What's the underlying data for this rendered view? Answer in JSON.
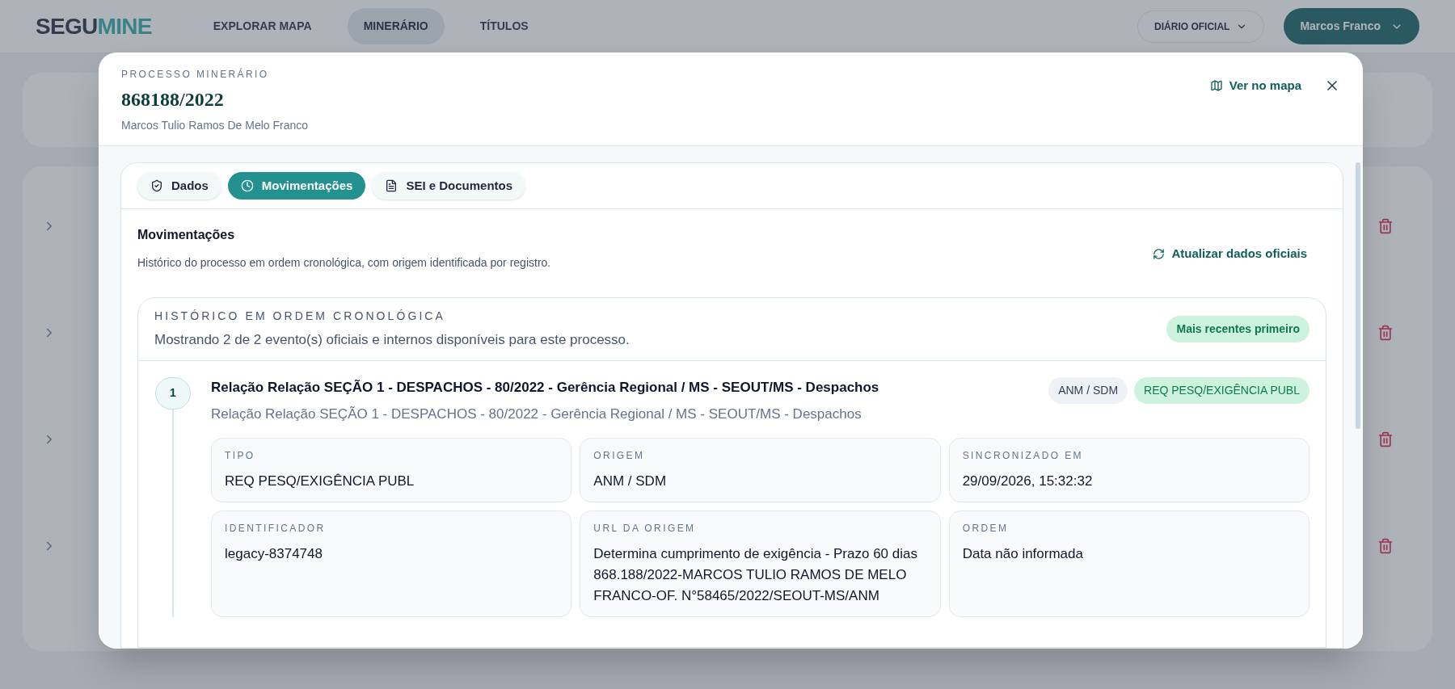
{
  "nav": {
    "logo_part_1": "SEGU",
    "logo_part_2": "MINE",
    "links": [
      {
        "label": "EXPLORAR MAPA",
        "selected": false
      },
      {
        "label": "MINERÁRIO",
        "selected": true
      },
      {
        "label": "TÍTULOS",
        "selected": false
      }
    ],
    "journal_menu": "DIÁRIO OFICIAL",
    "user_menu": "Marcos Franco"
  },
  "modal": {
    "eyebrow": "PROCESSO MINERÁRIO",
    "title": "868188/2022",
    "subtitle": "Marcos Tulio Ramos De Melo Franco",
    "map_link": "Ver no mapa",
    "tabs": [
      {
        "label": "Dados",
        "selected": false
      },
      {
        "label": "Movimentações",
        "selected": true
      },
      {
        "label": "SEI e Documentos",
        "selected": false
      }
    ],
    "section": {
      "title": "Movimentações",
      "description": "Histórico do processo em ordem cronológica, com origem identificada por registro.",
      "refresh_button": "Atualizar dados oficiais"
    },
    "history": {
      "eyebrow": "HISTÓRICO EM ORDEM CRONOLÓGICA",
      "summary": "Mostrando 2 de 2 evento(s) oficiais e internos disponíveis para este processo.",
      "order_badge": "Mais recentes primeiro"
    },
    "events": [
      {
        "number": "1",
        "title": "Relação Relação SEÇÃO 1 - DESPACHOS - 80/2022 - Gerência Regional / MS - SEOUT/MS - Despachos",
        "subtitle": "Relação Relação SEÇÃO 1 - DESPACHOS - 80/2022 - Gerência Regional / MS - SEOUT/MS - Despachos",
        "tags": [
          {
            "label": "ANM / SDM",
            "kind": "neutral"
          },
          {
            "label": "REQ PESQ/EXIGÊNCIA PUBL",
            "kind": "success"
          }
        ],
        "fields": [
          {
            "label": "TIPO",
            "value": "REQ PESQ/EXIGÊNCIA PUBL"
          },
          {
            "label": "ORIGEM",
            "value": "ANM / SDM"
          },
          {
            "label": "SINCRONIZADO EM",
            "value": "29/09/2026, 15:32:32"
          },
          {
            "label": "IDENTIFICADOR",
            "value": "legacy-8374748"
          },
          {
            "label": "URL DA ORIGEM",
            "value": "Determina cumprimento de exigência - Prazo 60 dias 868.188/2022-MARCOS TULIO RAMOS DE MELO FRANCO-OF. N°58465/2022/SEOUT-MS/ANM"
          },
          {
            "label": "ORDEM",
            "value": "Data não informada"
          }
        ]
      }
    ]
  }
}
